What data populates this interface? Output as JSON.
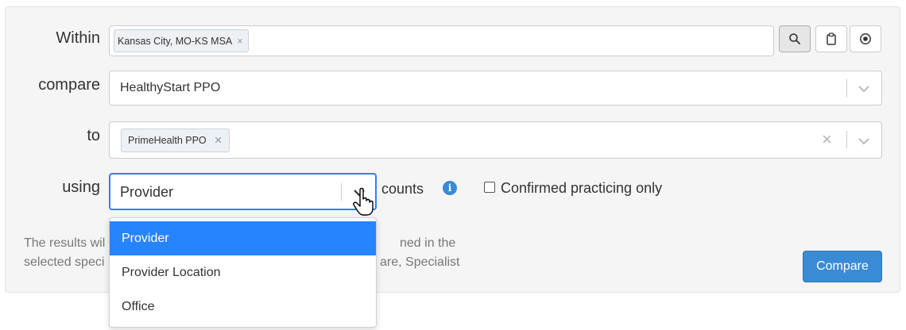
{
  "labels": {
    "within": "Within",
    "compare": "compare",
    "to": "to",
    "using": "using"
  },
  "within": {
    "tags": [
      {
        "label": "Kansas City, MO-KS MSA",
        "remove": "×"
      }
    ],
    "buttons": [
      "search-icon",
      "clipboard-icon",
      "radio-dot-icon"
    ]
  },
  "compare": {
    "value": "HealthyStart PPO"
  },
  "to": {
    "tags": [
      {
        "label": "PrimeHealth PPO",
        "remove": "×"
      }
    ],
    "clear": "×"
  },
  "using": {
    "value": "Provider",
    "suffix": "counts",
    "info_icon": "i",
    "confirmed_label": "Confirmed practicing only",
    "options": [
      "Provider",
      "Provider Location",
      "Office"
    ],
    "selected_index": 0
  },
  "description": {
    "line1_left": "The results wil",
    "line1_right": "ned in the",
    "line2_left": "selected speci",
    "line2_right": "are, Specialist"
  },
  "actions": {
    "compare_label": "Compare"
  },
  "colors": {
    "accent": "#2684ff",
    "button_primary": "#3a8bd6",
    "info": "#3a8bd6"
  }
}
